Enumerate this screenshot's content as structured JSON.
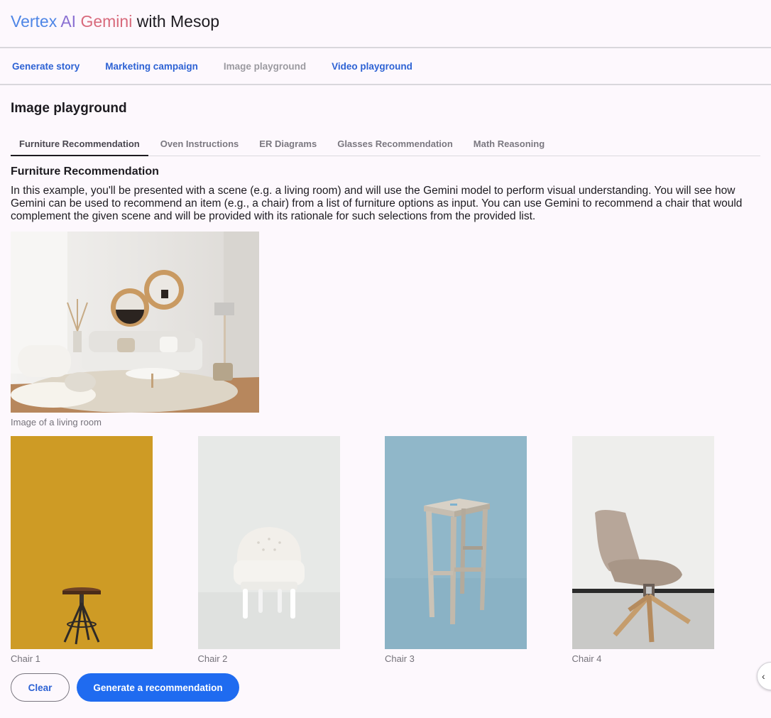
{
  "header": {
    "title_parts": {
      "vertex": "Vertex",
      "ai": "AI",
      "gemini": "Gemini",
      "rest": "with Mesop"
    }
  },
  "nav": {
    "items": [
      {
        "label": "Generate story",
        "disabled": false
      },
      {
        "label": "Marketing campaign",
        "disabled": false
      },
      {
        "label": "Image playground",
        "disabled": true
      },
      {
        "label": "Video playground",
        "disabled": false
      }
    ]
  },
  "page": {
    "title": "Image playground"
  },
  "tabs": [
    {
      "label": "Furniture Recommendation",
      "active": true
    },
    {
      "label": "Oven Instructions",
      "active": false
    },
    {
      "label": "ER Diagrams",
      "active": false
    },
    {
      "label": "Glasses Recommendation",
      "active": false
    },
    {
      "label": "Math Reasoning",
      "active": false
    }
  ],
  "section": {
    "title": "Furniture Recommendation",
    "description": "In this example, you'll be presented with a scene (e.g. a living room) and will use the Gemini model to perform visual understanding. You will see how Gemini can be used to recommend an item (e.g., a chair) from a list of furniture options as input. You can use Gemini to recommend a chair that would complement the given scene and will be provided with its rationale for such selections from the provided list."
  },
  "scene": {
    "caption": "Image of a living room"
  },
  "chairs": [
    {
      "caption": "Chair 1",
      "background": "#d19f2a"
    },
    {
      "caption": "Chair 2",
      "background": "#e7e9e7"
    },
    {
      "caption": "Chair 3",
      "background": "#90b7c9"
    },
    {
      "caption": "Chair 4",
      "background": "#eeeeec"
    }
  ],
  "actions": {
    "clear_label": "Clear",
    "generate_label": "Generate a recommendation"
  },
  "colors": {
    "accent": "#1f6bf0",
    "link": "#2d62d4"
  },
  "side_handle_icon": "chevron-left-icon"
}
